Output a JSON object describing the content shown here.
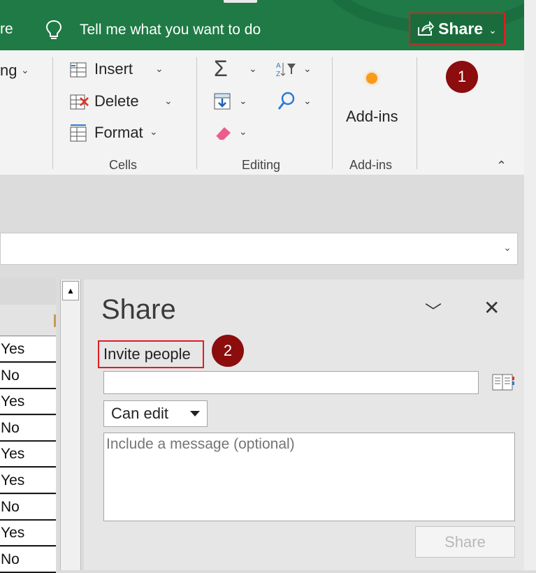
{
  "titlebar": {
    "partial_tab": "re",
    "tell_me": "Tell me what you want to do",
    "share_label": "Share",
    "share_chevron": "⌄"
  },
  "ribbon": {
    "partial_label": "ng",
    "cells": {
      "insert": "Insert",
      "delete": "Delete",
      "format": "Format",
      "group": "Cells"
    },
    "editing": {
      "group": "Editing"
    },
    "addins": {
      "label": "Add-ins",
      "group": "Add-ins"
    }
  },
  "sheet": {
    "rows": [
      "Yes",
      "No",
      "Yes",
      "No",
      "Yes",
      "Yes",
      "No",
      "Yes",
      "No"
    ]
  },
  "share_pane": {
    "title": "Share",
    "invite_label": "Invite people",
    "permission": "Can edit",
    "message_placeholder": "Include a message (optional)",
    "share_button": "Share"
  },
  "callouts": {
    "one": "1",
    "two": "2"
  },
  "colors": {
    "excel_green": "#1f7a45",
    "highlight_red": "#e11c24",
    "badge": "#8b0d0d",
    "addin_dot": "#f59c1a"
  },
  "icons": [
    "lightbulb-icon",
    "share-arrow-icon",
    "insert-cells-icon",
    "delete-cells-icon",
    "format-cells-icon",
    "autosum-icon",
    "sort-filter-icon",
    "fill-icon",
    "find-icon",
    "clear-icon",
    "addins-icon",
    "address-book-icon",
    "close-icon",
    "chevron-down-icon"
  ]
}
